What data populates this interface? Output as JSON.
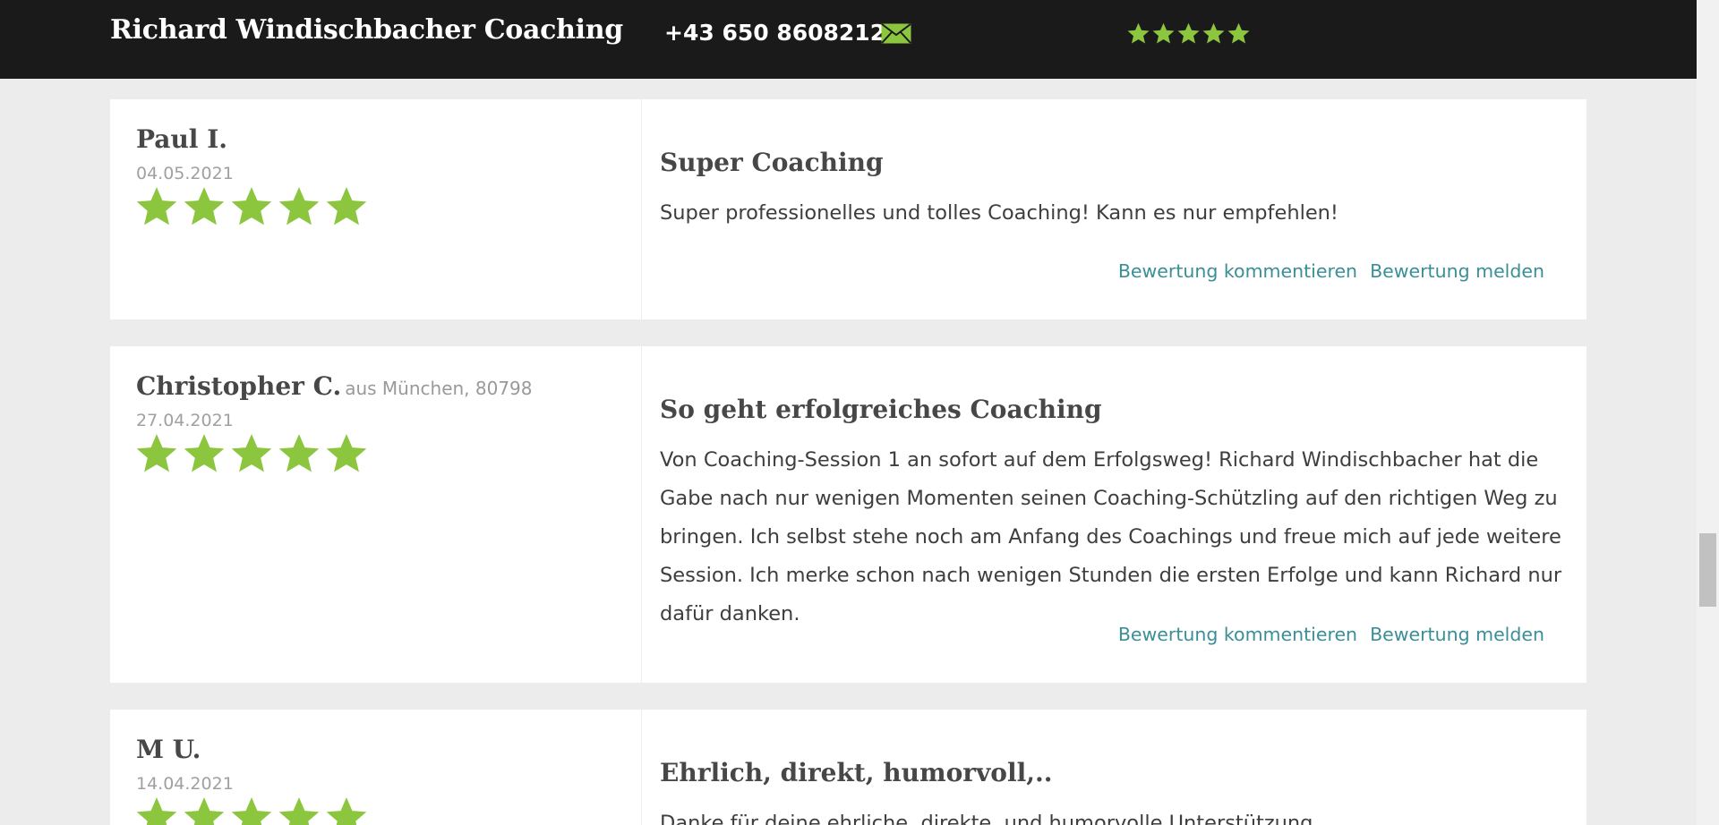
{
  "header": {
    "brand": "Richard Windischbacher Coaching",
    "phone": "+43 650 8608212",
    "mail_icon": "envelope-icon",
    "star_color": "#8cc63f",
    "rating_stars": 5
  },
  "reviews": [
    {
      "name": "Paul I.",
      "location": "",
      "date": "04.05.2021",
      "stars": 5,
      "title": "Super Coaching",
      "body": "Super professionelles und tolles Coaching! Kann es nur empfehlen!",
      "comment_label": "Bewertung kommentieren",
      "report_label": "Bewertung melden"
    },
    {
      "name": "Christopher C.",
      "location": "aus München, 80798",
      "date": "27.04.2021",
      "stars": 5,
      "title": "So geht erfolgreiches Coaching",
      "body": "Von Coaching-Session 1 an sofort auf dem Erfolgsweg! Richard Windischbacher hat die Gabe nach nur wenigen Momenten seinen Coaching-Schützling auf den richtigen Weg zu bringen. Ich selbst stehe noch am Anfang des Coachings und freue mich auf jede weitere Session. Ich merke schon nach wenigen Stunden die ersten Erfolge und kann Richard nur dafür danken.",
      "comment_label": "Bewertung kommentieren",
      "report_label": "Bewertung melden"
    },
    {
      "name": "M U.",
      "location": "",
      "date": "14.04.2021",
      "stars": 5,
      "title": "Ehrlich, direkt, humorvoll,..",
      "body": "Danke für deine ehrliche, direkte, und humorvolle Unterstützung.",
      "comment_label": "",
      "report_label": ""
    }
  ]
}
